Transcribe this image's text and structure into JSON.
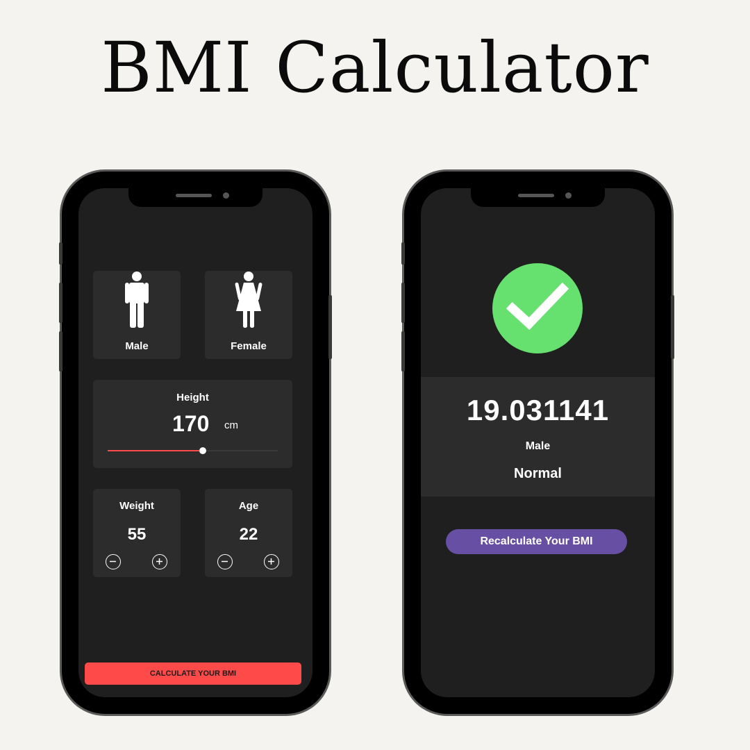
{
  "page": {
    "title": "BMI Calculator"
  },
  "input_screen": {
    "genders": [
      {
        "label": "Male",
        "icon": "male-icon"
      },
      {
        "label": "Female",
        "icon": "female-icon"
      }
    ],
    "height": {
      "label": "Height",
      "value": "170",
      "unit": "cm",
      "slider_fraction": 0.56
    },
    "weight": {
      "label": "Weight",
      "value": "55"
    },
    "age": {
      "label": "Age",
      "value": "22"
    },
    "calculate_label": "CALCULATE YOUR BMI",
    "colors": {
      "accent": "#ff4a4a",
      "card": "#2c2c2c",
      "screen": "#1f1f1f"
    }
  },
  "result_screen": {
    "status_icon": "check-circle-icon",
    "bmi_value": "19.031141",
    "gender": "Male",
    "category": "Normal",
    "recalculate_label": "Recalculate Your BMI",
    "colors": {
      "check": "#66e06f",
      "button": "#6750a4"
    }
  }
}
